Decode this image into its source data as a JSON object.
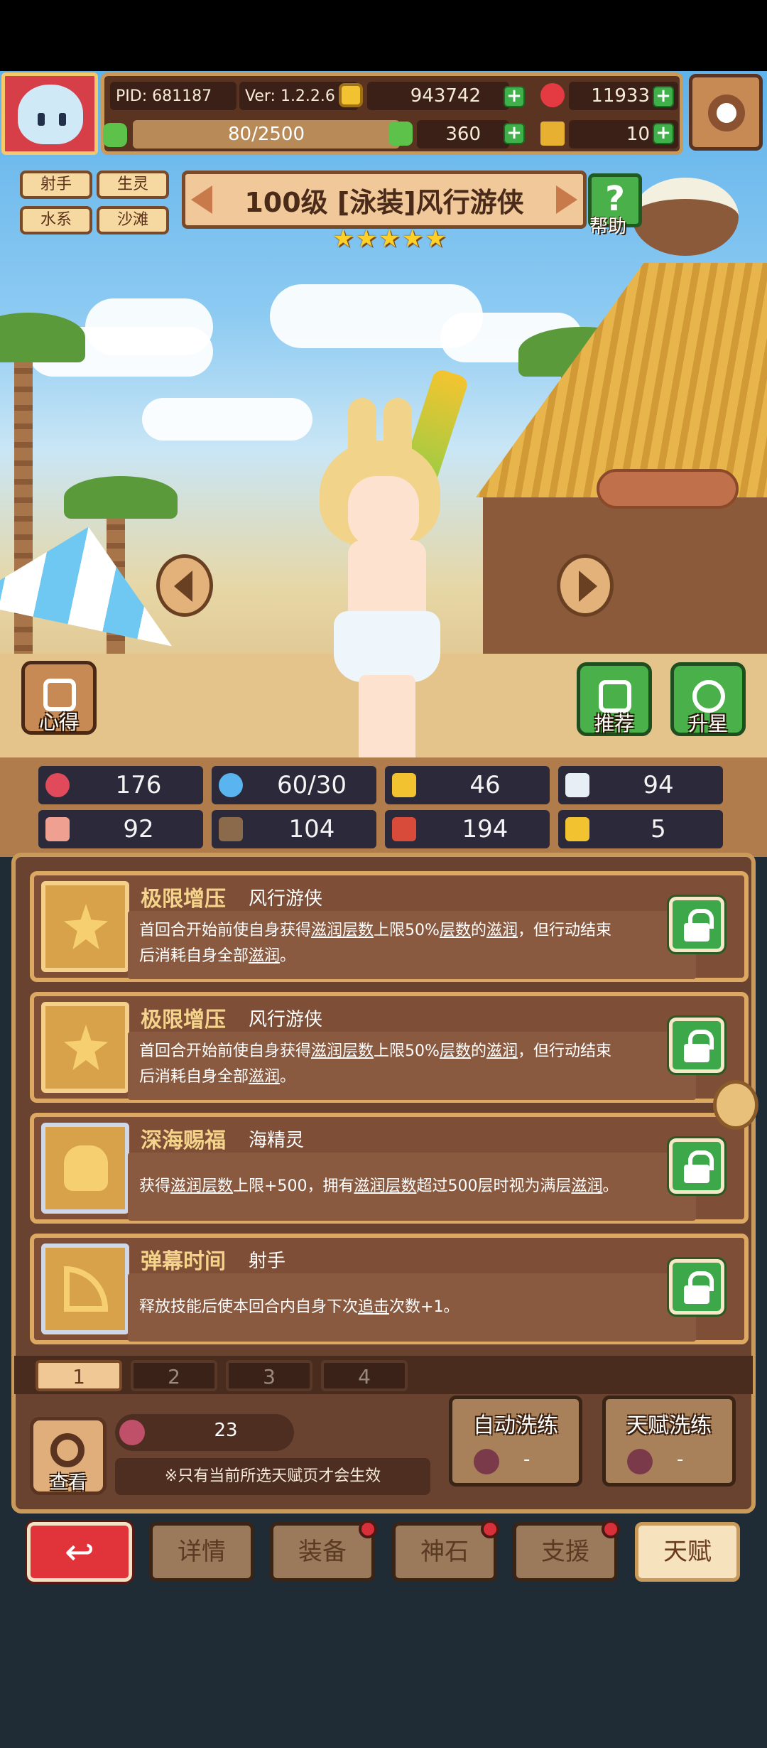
{
  "player": {
    "pid": "PID: 681187",
    "version": "Ver: 1.2.2.6",
    "energy": "80/2500"
  },
  "currencies": {
    "gold": "943742",
    "gems": "11933",
    "clover": "360",
    "keys": "10"
  },
  "hero": {
    "tags": [
      "射手",
      "生灵",
      "水系",
      "沙滩"
    ],
    "title": "100级 [泳装]风行游侠",
    "stars": 5
  },
  "buttons": {
    "help": "帮助",
    "xinde": "心得",
    "tuijian": "推荐",
    "shengxing": "升星",
    "view": "查看"
  },
  "stats": [
    {
      "icon": "heart-icon",
      "value": "176",
      "color": "#e04a5a"
    },
    {
      "icon": "water-drop-icon",
      "value": "60/30",
      "color": "#5ab4f0"
    },
    {
      "icon": "shield-icon",
      "value": "46",
      "color": "#f2c230"
    },
    {
      "icon": "wing-icon",
      "value": "94",
      "color": "#e8eef6"
    },
    {
      "icon": "fist-icon",
      "value": "92",
      "color": "#f0a090"
    },
    {
      "icon": "book-icon",
      "value": "104",
      "color": "#8a6a4a"
    },
    {
      "icon": "banner-icon",
      "value": "194",
      "color": "#d84a3a"
    },
    {
      "icon": "horseshoe-icon",
      "value": "5",
      "color": "#f2c230"
    }
  ],
  "talents": [
    {
      "name": "极限增压",
      "source": "风行游侠",
      "line1_parts": [
        "首回合开始前使自身获得",
        "滋润层数",
        "上限50%",
        "层数",
        "的",
        "滋润",
        "，但行动结束"
      ],
      "line2_parts": [
        "后消耗自身全部",
        "滋润",
        "。"
      ]
    },
    {
      "name": "极限增压",
      "source": "风行游侠",
      "line1_parts": [
        "首回合开始前使自身获得",
        "滋润层数",
        "上限50%",
        "层数",
        "的",
        "滋润",
        "，但行动结束"
      ],
      "line2_parts": [
        "后消耗自身全部",
        "滋润",
        "。"
      ]
    },
    {
      "name": "深海赐福",
      "source": "海精灵",
      "line1_parts": [
        "获得",
        "滋润层数",
        "上限+500，拥有",
        "滋润层数",
        "超过500层时视为满层",
        "滋润",
        "。"
      ]
    },
    {
      "name": "弹幕时间",
      "source": "射手",
      "line1_parts": [
        "释放技能后使本回合内自身下次",
        "追击",
        "次数+1。"
      ]
    }
  ],
  "pages": [
    "1",
    "2",
    "3",
    "4"
  ],
  "fruit_count": "23",
  "note": "※只有当前所选天赋页才会生效",
  "wash": {
    "auto_label": "自动洗练",
    "auto_value": "-",
    "talent_label": "天赋洗练",
    "talent_value": "-"
  },
  "nav": {
    "details": "详情",
    "equip": "装备",
    "stone": "神石",
    "support": "支援",
    "talent": "天赋"
  }
}
